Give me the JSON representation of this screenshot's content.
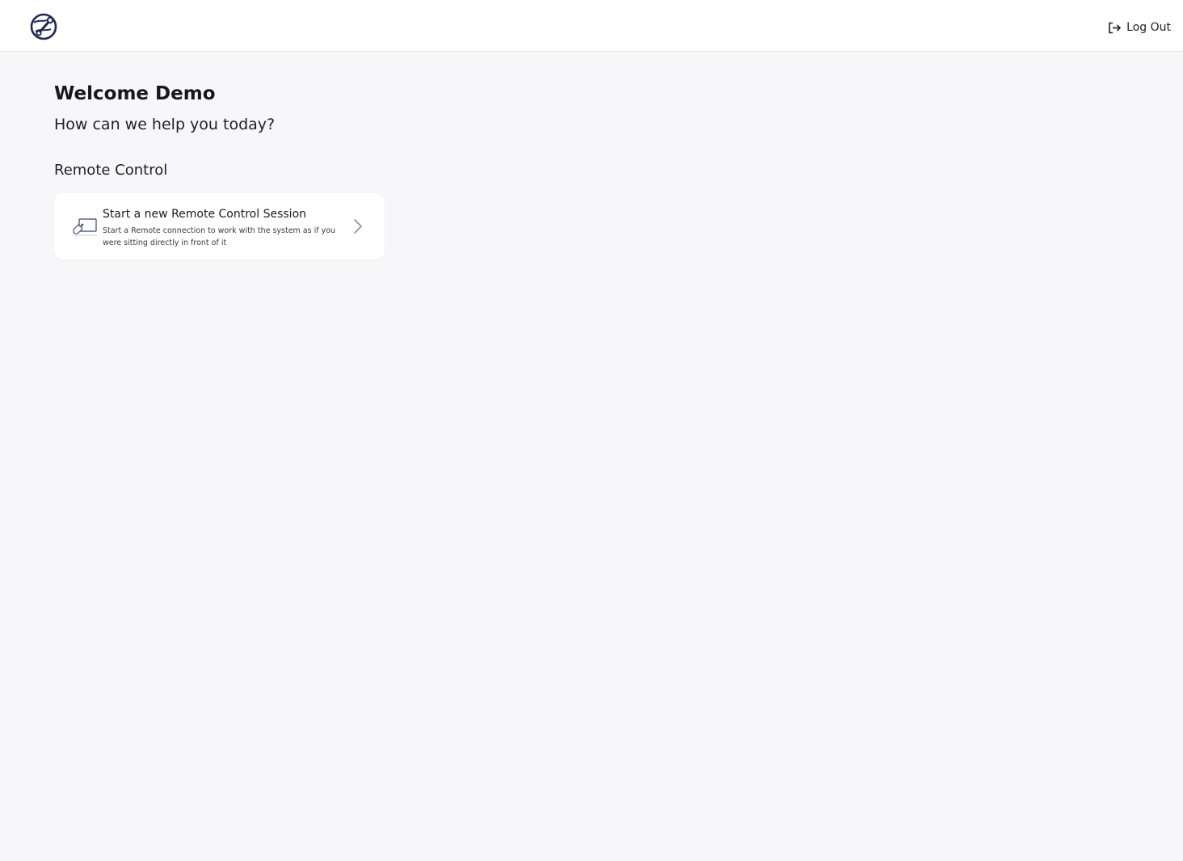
{
  "header": {
    "logo_icon": "globe-wrench-logo-icon",
    "logout_icon": "logout-icon",
    "logout_label": "Log Out"
  },
  "main": {
    "welcome": "Welcome Demo",
    "subtitle": "How can we help you today?",
    "section_title": "Remote Control",
    "card": {
      "icon": "remote-pointer-icon",
      "title": "Start a new Remote Control Session",
      "description": "Start a Remote connection to work with the system as if you were sitting directly in front of it",
      "chevron_icon": "chevron-right-icon"
    }
  },
  "colors": {
    "background": "#f7f7fa",
    "header_bg": "#ffffff",
    "brand_navy": "#1d2a57",
    "text_primary": "#1b1b22",
    "chevron": "#8a8fa8"
  }
}
